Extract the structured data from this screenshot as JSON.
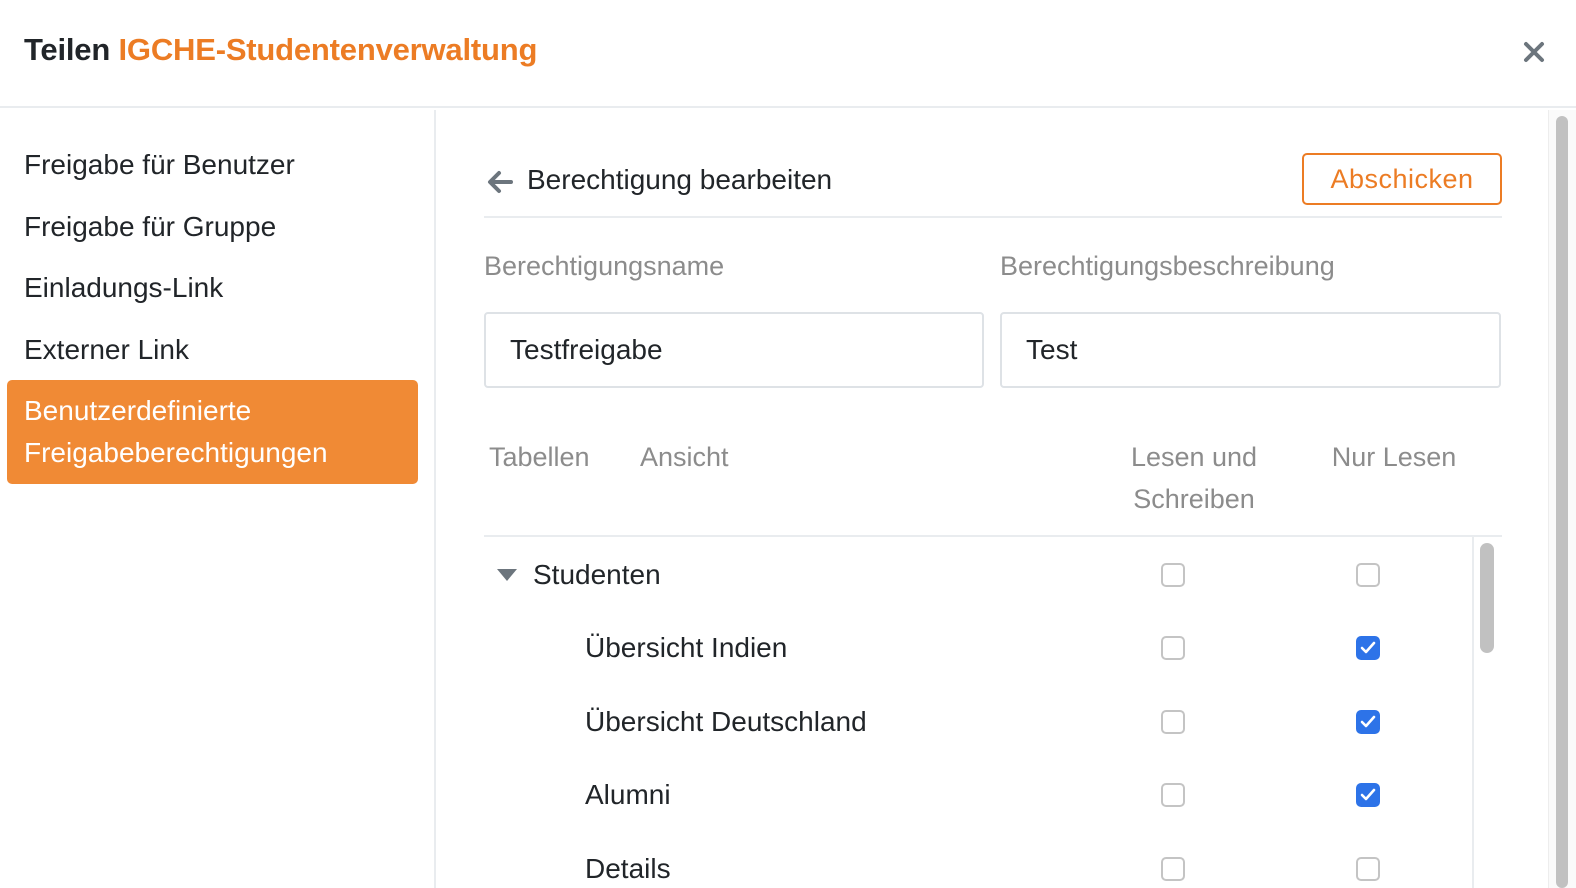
{
  "header": {
    "title_prefix": "Teilen",
    "base_name": "IGCHE-Studentenverwaltung"
  },
  "sidebar": {
    "items": [
      {
        "label": "Freigabe für Benutzer"
      },
      {
        "label": "Freigabe für Gruppe"
      },
      {
        "label": "Einladungs-Link"
      },
      {
        "label": "Externer Link"
      },
      {
        "label_line1": "Benutzerdefinierte",
        "label_line2": "Freigabeberechtigungen",
        "active": true
      }
    ]
  },
  "main": {
    "section_title": "Berechtigung bearbeiten",
    "submit_label": "Abschicken",
    "name_label": "Berechtigungsname",
    "name_value": "Testfreigabe",
    "description_label": "Berechtigungsbeschreibung",
    "description_value": "Test",
    "columns": {
      "tables": "Tabellen",
      "view": "Ansicht",
      "read_write_line1": "Lesen und",
      "read_write_line2": "Schreiben",
      "read_only": "Nur Lesen"
    },
    "rows": [
      {
        "label": "Studenten",
        "type": "table",
        "read_write": false,
        "read_only": false
      },
      {
        "label": "Übersicht Indien",
        "type": "view",
        "read_write": false,
        "read_only": true
      },
      {
        "label": "Übersicht Deutschland",
        "type": "view",
        "read_write": false,
        "read_only": true
      },
      {
        "label": "Alumni",
        "type": "view",
        "read_write": false,
        "read_only": true
      },
      {
        "label": "Details",
        "type": "view",
        "read_write": false,
        "read_only": false
      }
    ]
  },
  "colors": {
    "accent": "#ec7c24",
    "active_nav_bg": "#f08a35",
    "checkbox_checked": "#2d73e8"
  },
  "icons": {
    "close": "close-icon",
    "back": "arrow-left-icon",
    "expand": "caret-down-icon",
    "check": "checkmark-icon"
  }
}
